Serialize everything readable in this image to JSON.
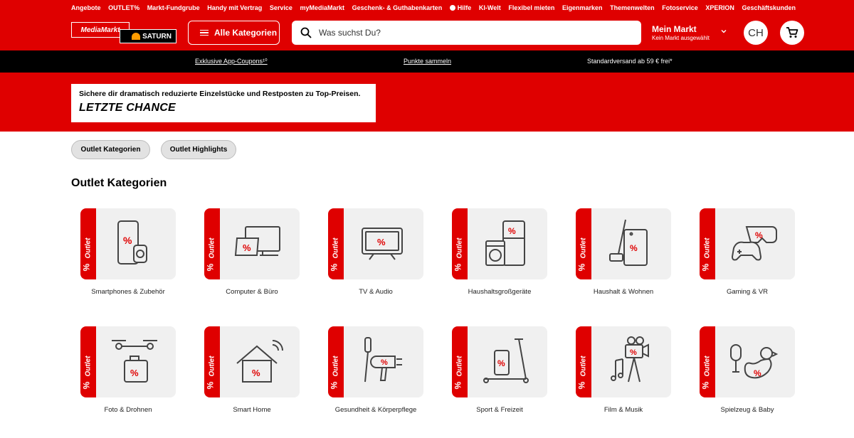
{
  "topnav": [
    "Angebote",
    "OUTLET%",
    "Markt-Fundgrube",
    "Handy mit Vertrag",
    "Service",
    "myMediaMarkt",
    "Geschenk- & Guthabenkarten",
    "Hilfe",
    "KI-Welt",
    "Flexibel mieten",
    "Eigenmarken",
    "Themenwelten",
    "Fotoservice",
    "XPERION",
    "Geschäftskunden"
  ],
  "logo": {
    "mediamarkt": "MediaMarkt",
    "saturn": "SATURN"
  },
  "header": {
    "categories_label": "Alle Kategorien",
    "search_placeholder": "Was suchst Du?",
    "markt_title": "Mein Markt",
    "markt_sub": "Kein Markt ausgewählt",
    "avatar": "CH"
  },
  "promo": {
    "coupons": "Exklusive App-Coupons¹⁰",
    "points": "Punkte sammeln",
    "shipping": "Standardversand ab 59 € frei*"
  },
  "hero": {
    "subtitle": "Sichere dir dramatisch reduzierte Einzelstücke und Restposten zu Top-Preisen.",
    "title": "LETZTE CHANCE"
  },
  "chips": [
    "Outlet Kategorien",
    "Outlet Highlights"
  ],
  "section_title": "Outlet Kategorien",
  "ribbon_text": "Outlet",
  "ribbon_percent": "%",
  "categories": [
    "Smartphones & Zubehör",
    "Computer & Büro",
    "TV & Audio",
    "Haushaltsgroßgeräte",
    "Haushalt & Wohnen",
    "Gaming & VR",
    "Foto & Drohnen",
    "Smart Home",
    "Gesundheit & Körperpflege",
    "Sport & Freizeit",
    "Film & Musik",
    "Spielzeug & Baby"
  ],
  "colors": {
    "brand_red": "#df0000",
    "promo_black": "#000000",
    "tile_bg": "#f0f0f0"
  }
}
